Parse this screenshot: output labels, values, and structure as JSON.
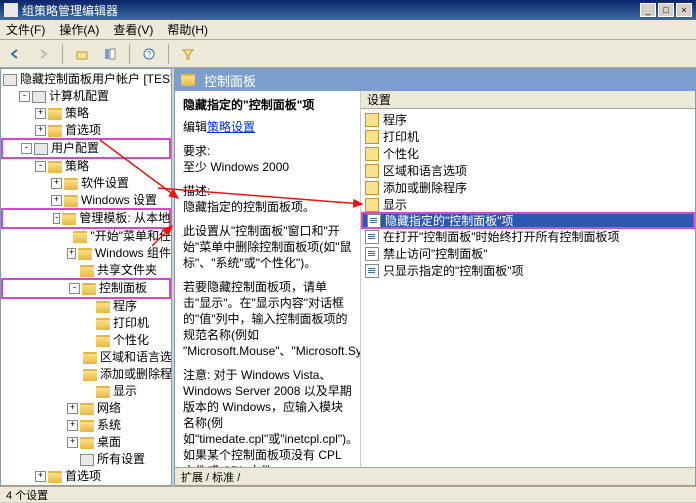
{
  "window": {
    "title": "组策略管理编辑器",
    "min": "_",
    "max": "□",
    "close": "×"
  },
  "menu": {
    "file": "文件(F)",
    "action": "操作(A)",
    "view": "查看(V)",
    "help": "帮助(H)"
  },
  "tree": {
    "root": "隐藏控制面板用户帐户 [TEST-F",
    "computer_cfg": "计算机配置",
    "policies1": "策略",
    "prefs1": "首选项",
    "user_cfg": "用户配置",
    "policies2": "策略",
    "soft": "软件设置",
    "winset": "Windows 设置",
    "admtpl": "管理模板: 从本地计",
    "start": "\"开始\"菜单和任",
    "wincomp": "Windows 组件",
    "shared": "共享文件夹",
    "ctrlpanel": "控制面板",
    "programs": "程序",
    "printers": "打印机",
    "personalize": "个性化",
    "region": "区域和语言选",
    "addremove": "添加或删除程",
    "display": "显示",
    "network": "网络",
    "system": "系统",
    "desktop": "桌面",
    "allset": "所有设置",
    "prefs2": "首选项"
  },
  "main": {
    "header": "控制面板",
    "desc_title": "隐藏指定的\"控制面板\"项",
    "edit_link_label": "编辑",
    "edit_link": "策略设置",
    "req_label": "要求:",
    "req_value": "至少 Windows 2000",
    "desc_label": "描述:",
    "desc_line1": "隐藏指定的控制面板项。",
    "desc_p2": "此设置从\"控制面板\"窗口和\"开始\"菜单中删除控制面板项(如\"鼠标\"、\"系统\"或\"个性化\")。",
    "desc_p3": "若要隐藏控制面板项，请单击\"显示\"。在\"显示内容\"对话框的\"值\"列中，输入控制面板项的规范名称(例如 \"Microsoft.Mouse\"、\"Microsoft.System\"或\"Microsoft.Personalization\")。",
    "desc_p4": "注意:  对于 Windows Vista、Windows Server 2008 以及早期版本的 Windows，应输入模块名称(例如\"timedate.cpl\"或\"inetcpl.cpl\")。如果某个控制面板项没有 CPL 文件或 CPL 文件",
    "col_setting": "设置",
    "items": [
      {
        "t": "程序",
        "icon": "folder"
      },
      {
        "t": "打印机",
        "icon": "folder"
      },
      {
        "t": "个性化",
        "icon": "folder"
      },
      {
        "t": "区域和语言选项",
        "icon": "folder"
      },
      {
        "t": "添加或删除程序",
        "icon": "folder"
      },
      {
        "t": "显示",
        "icon": "folder"
      },
      {
        "t": "隐藏指定的\"控制面板\"项",
        "icon": "doc",
        "selected": true,
        "highlight": true
      },
      {
        "t": "在打开\"控制面板\"时始终打开所有控制面板项",
        "icon": "doc"
      },
      {
        "t": "禁止访问\"控制面板\"",
        "icon": "doc"
      },
      {
        "t": "只显示指定的\"控制面板\"项",
        "icon": "doc"
      }
    ],
    "expbar_label": "扩展 / 标准 /"
  },
  "status": "4 个设置"
}
